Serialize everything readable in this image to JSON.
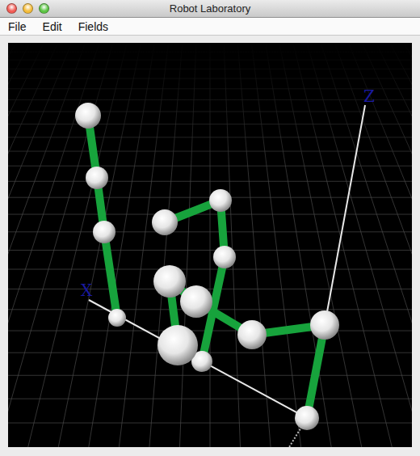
{
  "window": {
    "title": "Robot Laboratory"
  },
  "menu": [
    {
      "label": "File"
    },
    {
      "label": "Edit"
    },
    {
      "label": "Fields"
    }
  ],
  "viewport": {
    "axes": [
      {
        "label": "X",
        "color": "#1a1aa0"
      },
      {
        "label": "Z",
        "color": "#1a1aa0"
      }
    ]
  }
}
